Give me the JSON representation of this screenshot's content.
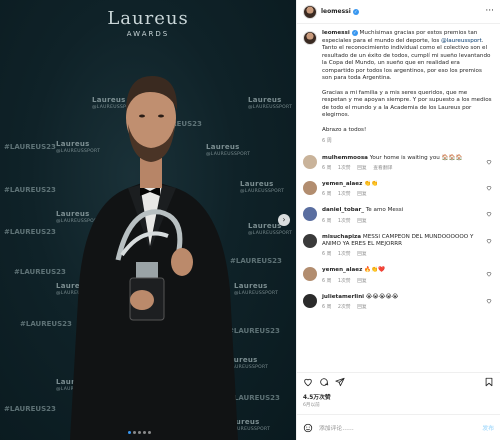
{
  "photo": {
    "brand_logo": "Laureus",
    "brand_sub": "AWARDS",
    "watermark_main": "Laureus",
    "watermark_sub": "@LAUREUSSPORT",
    "hashtag": "#LAUREUS23",
    "next_icon": "chevron-right-icon"
  },
  "header": {
    "username": "leomessi",
    "more_icon": "more-horizontal-icon"
  },
  "caption": {
    "username": "leomessi",
    "text_1a": "Muchísimas gracias por estos premios tan especiales para el mundo del deporte, los ",
    "mention": "@laureussport",
    "text_1b": ". Tanto el reconocimiento individual como el colectivo son el resultado de un éxito de todos, cumplí mi sueño levantando la Copa del Mundo, un sueño que en realidad era compartido por todos los argentinos, por eso los premios son para toda Argentina.",
    "text_2": "Gracias a mi familia y a mis seres queridos, que me respetan y me apoyan siempre. Y por supuesto a los medios de todo el mundo y a la Academia de los Laureus por elegirnos.",
    "text_3": "Abrazo a todos!",
    "time": "6 周"
  },
  "comments": [
    {
      "user": "mulhemmoosa",
      "text": "Your home is waiting you 🏠🏠🏠",
      "time": "6 周",
      "likes": "1次赞",
      "reply": "回复",
      "translate": "查看翻译"
    },
    {
      "user": "yemen_alaez",
      "text": "👏👏",
      "time": "6 周",
      "likes": "1次赞",
      "reply": "回复",
      "translate": ""
    },
    {
      "user": "daniel_tobar_",
      "text": "Te amo Messi",
      "time": "6 周",
      "likes": "1次赞",
      "reply": "回复",
      "translate": ""
    },
    {
      "user": "misuchapiza",
      "text": "MESSI CAMPEON DEL MUNDOOOOOO Y ANIMO YA ERES EL MEJORRR",
      "time": "6 周",
      "likes": "1次赞",
      "reply": "回复",
      "translate": ""
    },
    {
      "user": "yemen_alaez",
      "text": "🔥👏❤️",
      "time": "6 周",
      "likes": "1次赞",
      "reply": "回复",
      "translate": ""
    },
    {
      "user": "julietamerlini",
      "text": "😭😭😭😭😭",
      "time": "6 周",
      "likes": "2次赞",
      "reply": "回复",
      "translate": ""
    }
  ],
  "actions": {
    "like_icon": "heart-icon",
    "comment_icon": "comment-icon",
    "share_icon": "send-icon",
    "save_icon": "bookmark-icon"
  },
  "likes": "4.5万次赞",
  "date": "6月以前",
  "add_comment": {
    "emoji_icon": "smile-icon",
    "placeholder": "添加评论……",
    "post_label": "发布"
  },
  "colors": {
    "accent": "#3897f0",
    "photo_bg": "#0f2228"
  }
}
